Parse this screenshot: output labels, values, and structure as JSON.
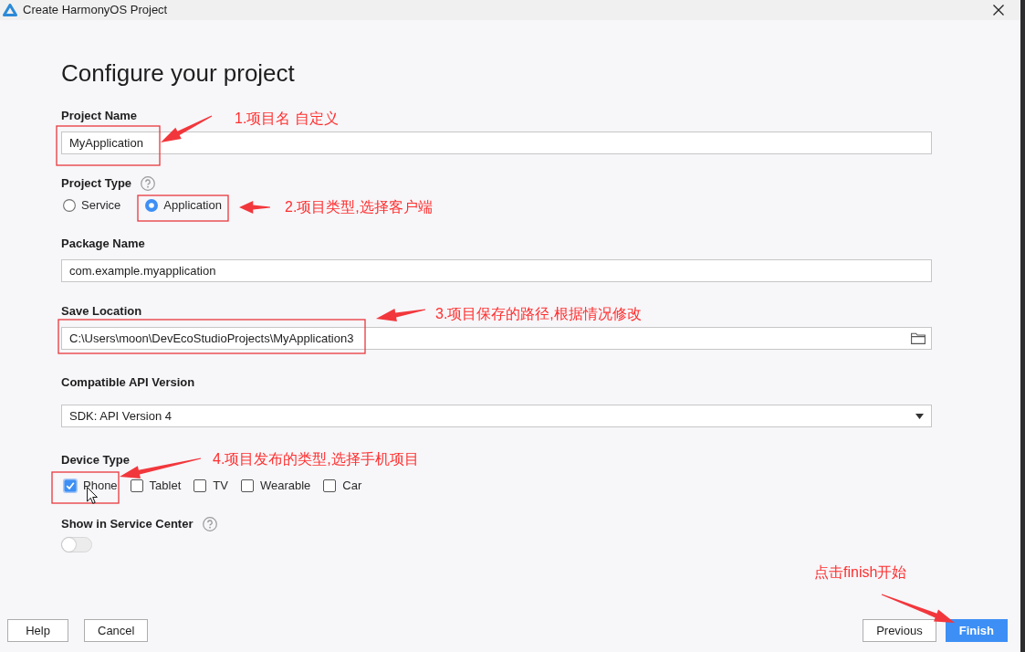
{
  "window": {
    "title": "Create HarmonyOS Project"
  },
  "heading": "Configure your project",
  "fields": [
    {
      "kind": "text",
      "label": "Project Name",
      "value": "MyApplication"
    },
    {
      "kind": "radio",
      "label": "Project Type",
      "help": true,
      "options": [
        {
          "label": "Service",
          "selected": false
        },
        {
          "label": "Application",
          "selected": true
        }
      ]
    },
    {
      "kind": "text",
      "label": "Package Name",
      "value": "com.example.myapplication"
    },
    {
      "kind": "path",
      "label": "Save Location",
      "value": "C:\\Users\\moon\\DevEcoStudioProjects\\MyApplication3"
    },
    {
      "kind": "select",
      "label": "Compatible API Version",
      "value": "SDK: API Version 4"
    },
    {
      "kind": "checkboxes",
      "label": "Device Type",
      "options": [
        {
          "label": "Phone",
          "checked": true
        },
        {
          "label": "Tablet",
          "checked": false
        },
        {
          "label": "TV",
          "checked": false
        },
        {
          "label": "Wearable",
          "checked": false
        },
        {
          "label": "Car",
          "checked": false
        }
      ]
    },
    {
      "kind": "toggle",
      "label": "Show in Service Center",
      "help": true,
      "on": false
    }
  ],
  "footer": {
    "left_buttons": [
      {
        "label": "Help",
        "kind": "default"
      },
      {
        "label": "Cancel",
        "kind": "default"
      }
    ],
    "right_buttons": [
      {
        "label": "Previous",
        "kind": "default"
      },
      {
        "label": "Finish",
        "kind": "primary"
      }
    ]
  },
  "annotations": [
    {
      "text": "1.项目名 自定义",
      "highlight": true
    },
    {
      "text": "2.项目类型,选择客户端",
      "highlight": true
    },
    {
      "text": "3.项目保存的路径,根据情况修改",
      "highlight": true
    },
    {
      "text": "4.项目发布的类型,选择手机项目",
      "highlight": true
    },
    {
      "text": "点击finish开始",
      "highlight": false
    }
  ]
}
